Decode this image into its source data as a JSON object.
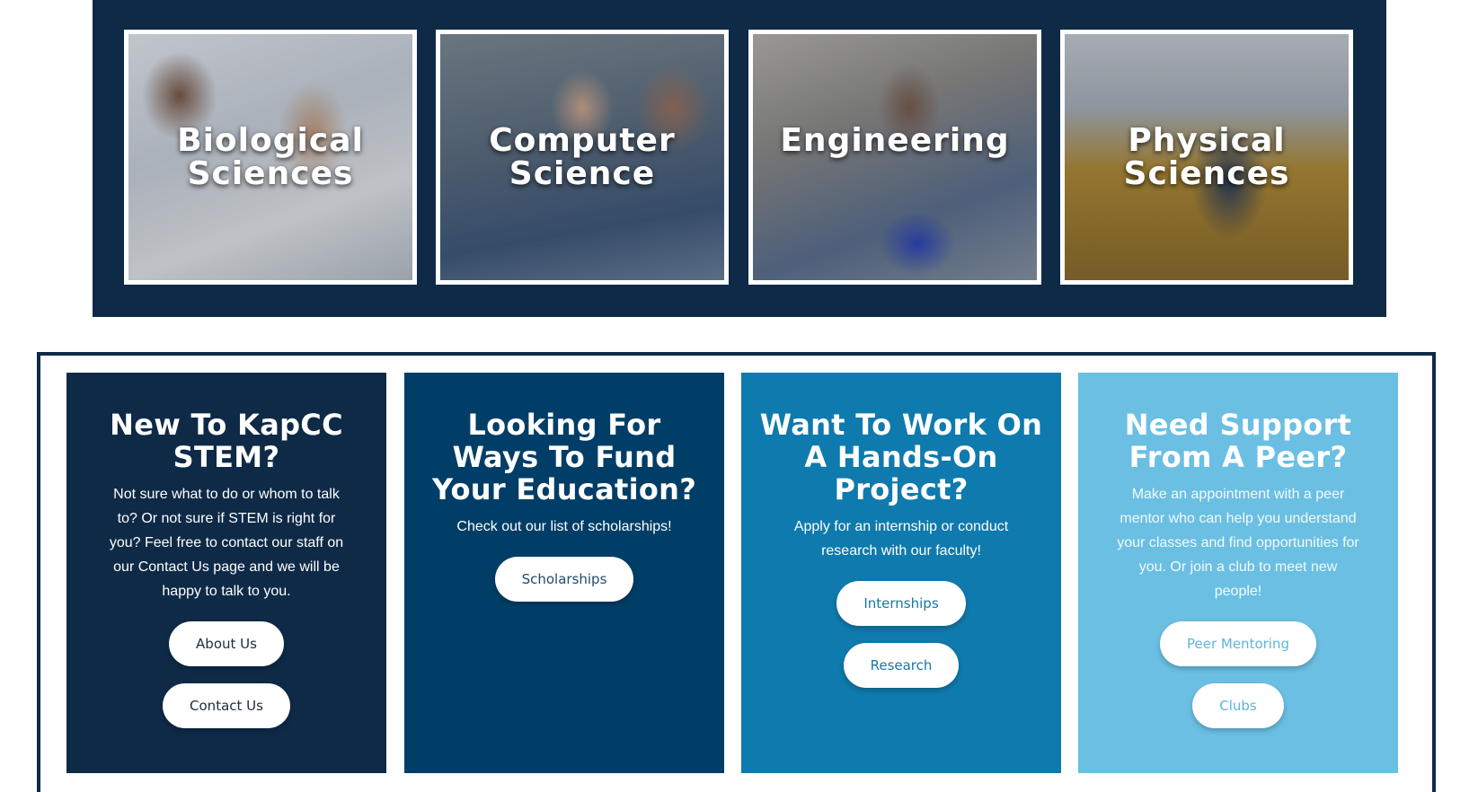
{
  "disciplines": {
    "tiles": [
      {
        "label": "Biological\nSciences",
        "photo": "lab-students-pipette-photo"
      },
      {
        "label": "Computer\nScience",
        "photo": "students-laptop-photo"
      },
      {
        "label": "Engineering",
        "photo": "engineering-workbench-photo"
      },
      {
        "label": "Physical\nSciences",
        "photo": "physics-lab-photo"
      }
    ]
  },
  "cards": [
    {
      "title": "New To KapCC STEM?",
      "text": "Not sure what to do or whom to talk to? Or not sure if STEM is right for you? Feel free to contact our staff on our Contact Us page and we will be happy to talk to you.",
      "buttons": [
        "About Us",
        "Contact Us"
      ]
    },
    {
      "title": "Looking For Ways To Fund Your Education?",
      "text": "Check out our list of scholarships!",
      "buttons": [
        "Scholarships"
      ]
    },
    {
      "title": "Want To Work On A Hands-On Project?",
      "text": "Apply for an internship or conduct research with our faculty!",
      "buttons": [
        "Internships",
        "Research"
      ]
    },
    {
      "title": "Need Support From A Peer?",
      "text": "Make an appointment with a peer mentor who can help you understand your classes and find opportunities for you. Or join a club to meet new people!",
      "buttons": [
        "Peer Mentoring",
        "Clubs"
      ]
    }
  ],
  "colors": {
    "navy": "#0e2a47",
    "dark_blue": "#003e67",
    "medium_blue": "#0f7aad",
    "light_blue": "#6bbfe3"
  }
}
